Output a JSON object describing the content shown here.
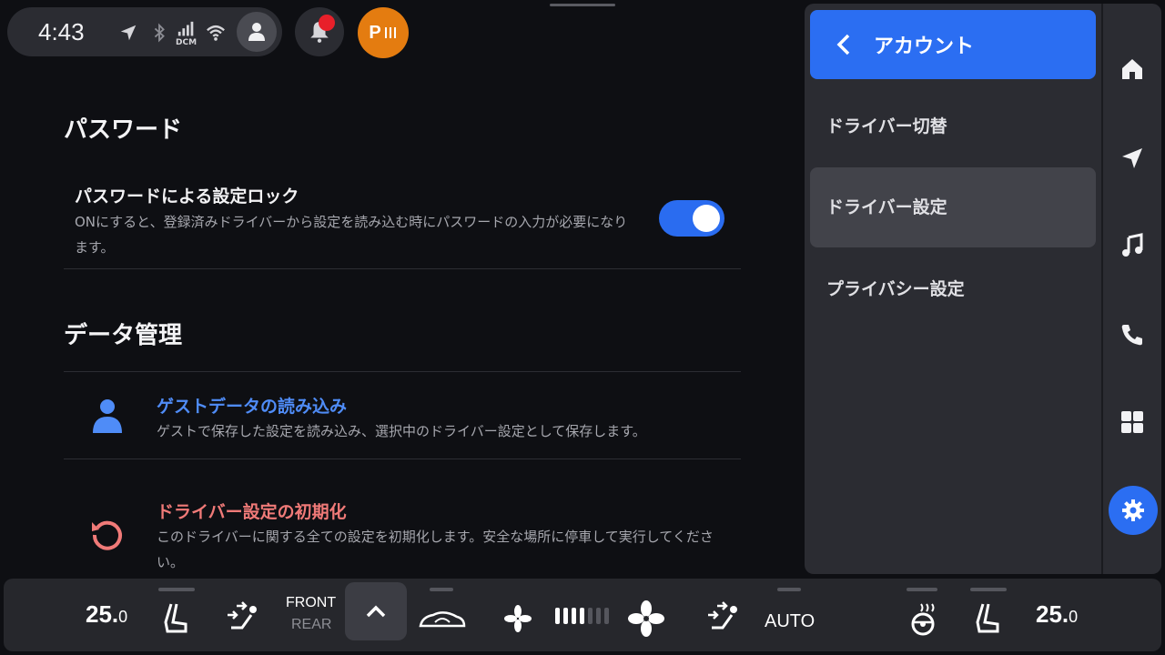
{
  "status_bar": {
    "time": "4:43",
    "dcm_label": "DCM",
    "park_label": "P"
  },
  "main": {
    "password_section": {
      "heading": "パスワード",
      "lock_title": "パスワードによる設定ロック",
      "lock_desc": "ONにすると、登録済みドライバーから設定を読み込む時にパスワードの入力が必要になります。",
      "lock_enabled": true
    },
    "data_section": {
      "heading": "データ管理",
      "guest_title": "ゲストデータの読み込み",
      "guest_desc": "ゲストで保存した設定を読み込み、選択中のドライバー設定として保存します。",
      "reset_title": "ドライバー設定の初期化",
      "reset_desc": "このドライバーに関する全ての設定を初期化します。安全な場所に停車して実行してください。"
    }
  },
  "panel": {
    "header_title": "アカウント",
    "items": [
      {
        "label": "ドライバー切替",
        "active": false
      },
      {
        "label": "ドライバー設定",
        "active": true
      },
      {
        "label": "プライバシー設定",
        "active": false
      }
    ]
  },
  "climate": {
    "left_temp": "25.",
    "left_temp_decimal": "0",
    "right_temp": "25.",
    "right_temp_decimal": "0",
    "front_label": "FRONT",
    "rear_label": "REAR",
    "auto_label": "AUTO",
    "fan_level": 4,
    "fan_max": 7
  },
  "colors": {
    "accent": "#2b6ef2",
    "guest_title": "#4f8cf7",
    "reset_title": "#f07a78",
    "park": "#e47c10",
    "notif_dot": "#e8202a"
  }
}
